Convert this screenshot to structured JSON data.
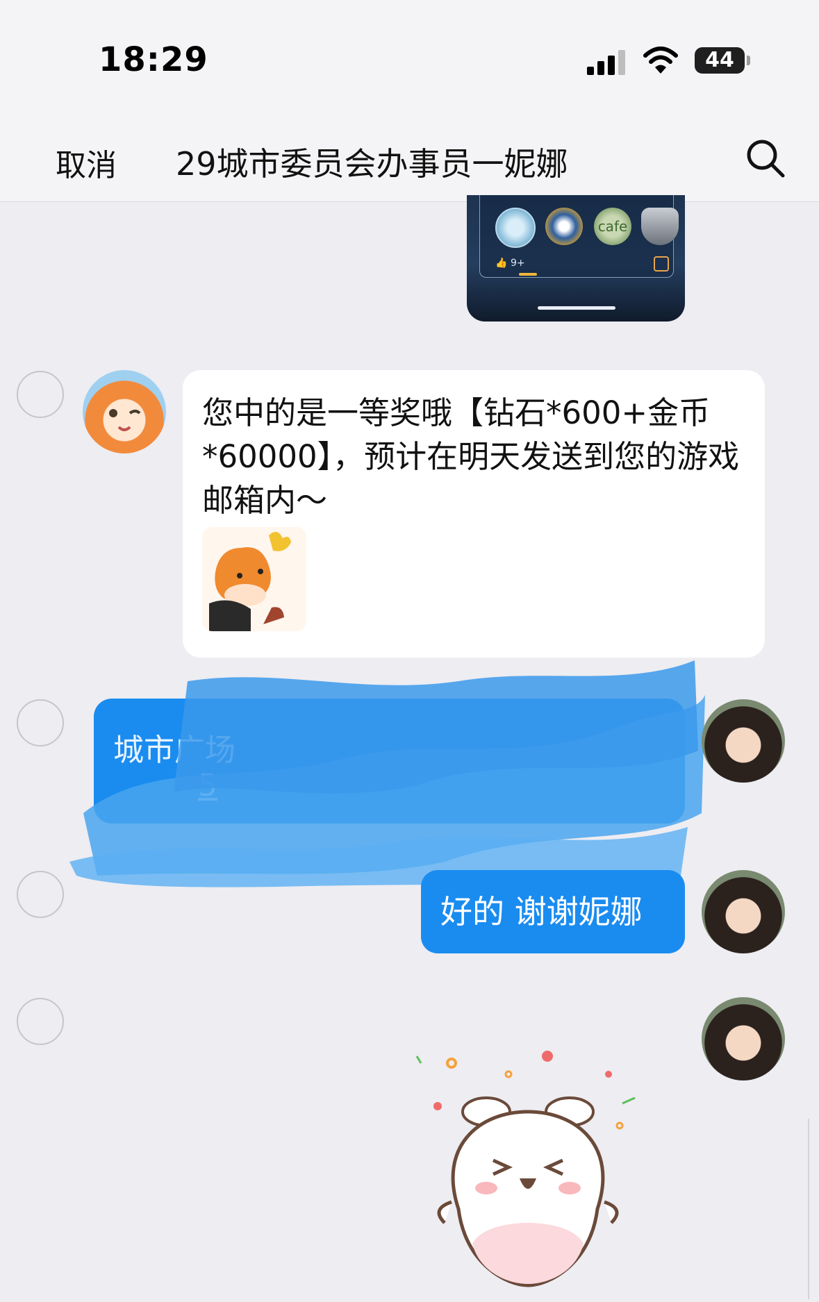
{
  "status_bar": {
    "time": "18:29",
    "battery_level": "44",
    "icons": [
      "cellular-signal-icon",
      "wifi-icon",
      "battery-icon"
    ]
  },
  "nav": {
    "cancel_label": "取消",
    "title": "29城市委员会办事员一妮娜",
    "search_icon": "search-icon"
  },
  "messages": [
    {
      "direction": "out",
      "type": "image"
    },
    {
      "direction": "in",
      "type": "text",
      "text": "您中的是一等奖哦【钻石*600+金币*60000】，预计在明天发送到您的游戏邮箱内～",
      "sticker": "fox-sticker"
    },
    {
      "direction": "out",
      "type": "text",
      "text_line1": "城市广场",
      "text_line2": "5",
      "redacted": true
    },
    {
      "direction": "out",
      "type": "text",
      "text": "好的 谢谢妮娜"
    },
    {
      "direction": "out",
      "type": "sticker",
      "sticker": "bunny-sticker"
    }
  ],
  "shared_image": {
    "badge_label": "cafe",
    "likes": "9+"
  },
  "colors": {
    "outgoing_bubble": "#1a8cf0",
    "incoming_bubble": "#ffffff",
    "background": "#ededf2"
  }
}
